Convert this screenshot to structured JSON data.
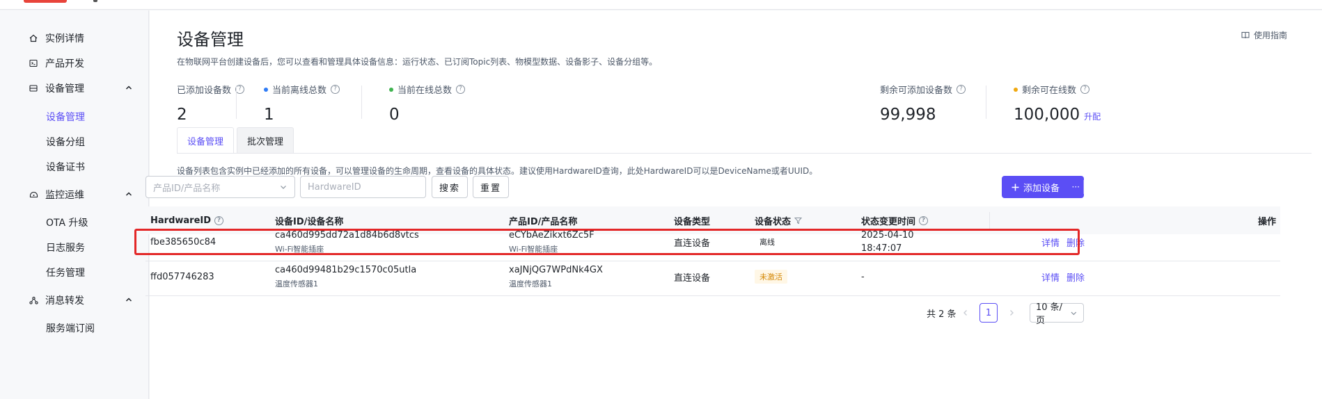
{
  "sidebar": {
    "items": [
      {
        "label": "实例详情",
        "icon": "home-icon"
      },
      {
        "label": "产品开发",
        "icon": "terminal-icon"
      },
      {
        "label": "设备管理",
        "icon": "device-icon"
      },
      {
        "label": "监控运维",
        "icon": "monitor-icon"
      },
      {
        "label": "消息转发",
        "icon": "share-icon"
      }
    ],
    "device_sub": [
      "设备管理",
      "设备分组",
      "设备证书"
    ],
    "monitor_sub": [
      "OTA 升级",
      "日志服务",
      "任务管理"
    ],
    "message_sub": [
      "服务端订阅"
    ]
  },
  "header": {
    "title": "设备管理",
    "description": "在物联网平台创建设备后，您可以查看和管理具体设备信息：运行状态、已订阅Topic列表、物模型数据、设备影子、设备分组等。",
    "guide_label": "使用指南"
  },
  "stats": {
    "added_label": "已添加设备数",
    "added_value": "2",
    "offline_label": "当前离线总数",
    "offline_value": "1",
    "online_label": "当前在线总数",
    "online_value": "0",
    "remaining_label": "剩余可添加设备数",
    "remaining_value": "99,998",
    "remaining_online_label": "剩余可在线数",
    "remaining_online_value": "100,000",
    "upgrade_label": "升配"
  },
  "tabs": [
    {
      "label": "设备管理",
      "active": true
    },
    {
      "label": "批次管理",
      "active": false
    }
  ],
  "list_description": "设备列表包含实例中已经添加的所有设备，可以管理设备的生命周期，查看设备的具体状态。建议使用HardwareID查询，此处HardwareID可以是DeviceName或者UUID。",
  "filters": {
    "product_placeholder": "产品ID/产品名称",
    "hardware_placeholder": "HardwareID",
    "search_label": "搜索",
    "reset_label": "重置",
    "add_label": "添加设备",
    "more_label": "···"
  },
  "table": {
    "columns": [
      "HardwareID",
      "设备ID/设备名称",
      "产品ID/产品名称",
      "设备类型",
      "设备状态",
      "状态变更时间",
      "操作"
    ],
    "rows": [
      {
        "hardware_id": "fbe385650c84",
        "device_id": "ca460d995dd72a1d84b6d8vtcs",
        "device_name": "Wi-Fi智能插座",
        "product_id": "eCYbAeZikxt6Zc5F",
        "product_name": "Wi-Fi智能插座",
        "type": "直连设备",
        "status": "离线",
        "changed_date": "2025-04-10",
        "changed_time": "18:47:07",
        "action_detail": "详情",
        "action_delete": "删除"
      },
      {
        "hardware_id": "ffd057746283",
        "device_id": "ca460d99481b29c1570c05utla",
        "device_name": "温度传感器1",
        "product_id": "xaJNjQG7WPdNk4GX",
        "product_name": "温度传感器1",
        "type": "直连设备",
        "status": "未激活",
        "changed_date": "-",
        "changed_time": "",
        "action_detail": "详情",
        "action_delete": "删除"
      }
    ]
  },
  "pagination": {
    "total": "共 2 条",
    "current_page": "1",
    "page_size": "10 条/页"
  },
  "colors": {
    "accent": "#5b4ef5",
    "offline_dot": "#2f7cf6",
    "online_dot": "#3fb34f",
    "remaining_dot": "#f0a80f",
    "highlight": "#e32727"
  }
}
